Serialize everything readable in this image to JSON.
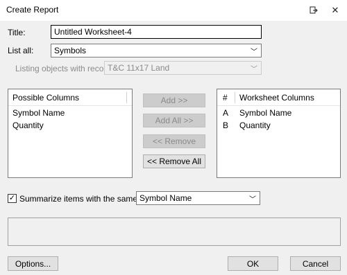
{
  "window": {
    "title": "Create Report",
    "icons": {
      "restore": "restore-window-icon",
      "close": "close-icon"
    }
  },
  "form": {
    "title_label": "Title:",
    "title_value": "Untitled Worksheet-4",
    "list_all_label": "List all:",
    "list_all_value": "Symbols",
    "listing_label": "Listing objects with record:",
    "listing_value": "T&C 11x17 Land"
  },
  "possible_columns": {
    "header": "Possible Columns",
    "items": [
      "Symbol Name",
      "Quantity"
    ]
  },
  "buttons": {
    "add": "Add >>",
    "add_all": "Add All >>",
    "remove": "<< Remove",
    "remove_all": "<< Remove All"
  },
  "worksheet_columns": {
    "header_num": "#",
    "header": "Worksheet Columns",
    "rows": [
      {
        "num": "A",
        "name": "Symbol Name"
      },
      {
        "num": "B",
        "name": "Quantity"
      }
    ]
  },
  "summarize": {
    "checked": true,
    "check_glyph": "✓",
    "label": "Summarize items with the same:",
    "value": "Symbol Name"
  },
  "footer": {
    "options": "Options...",
    "ok": "OK",
    "cancel": "Cancel"
  },
  "colors": {
    "dialog_bg": "#f0f0f0",
    "titlebar_bg": "#ffffff",
    "disabled_button_bg": "#cccccc"
  }
}
